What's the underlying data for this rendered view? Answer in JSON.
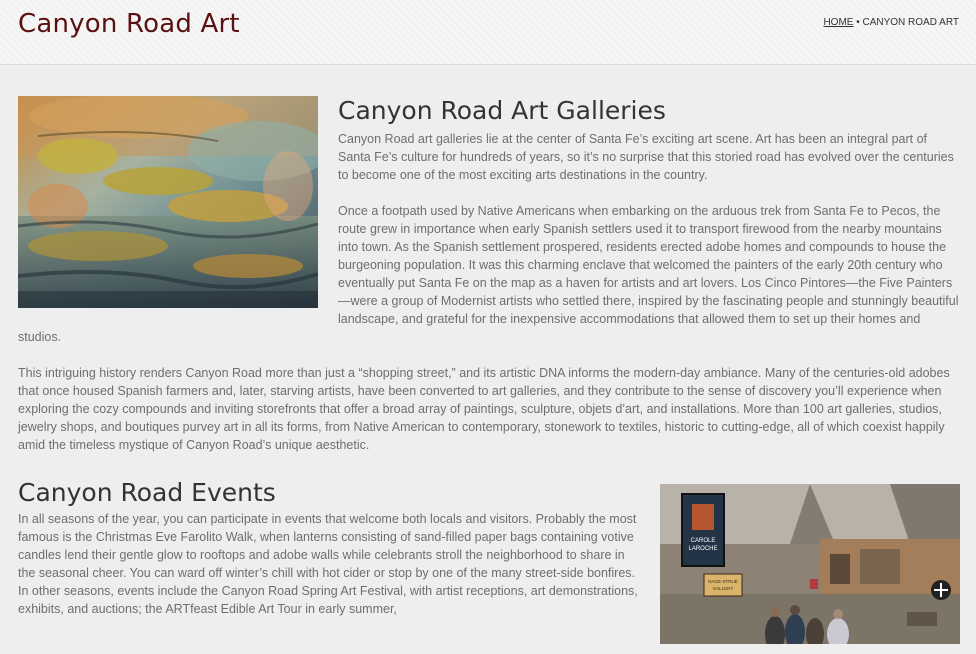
{
  "header": {
    "site_title": "Canyon Road Art",
    "breadcrumb": {
      "home": "HOME",
      "separator": " • ",
      "current": "CANYON ROAD ART"
    }
  },
  "galleries": {
    "title": "Canyon Road Art Galleries",
    "paragraphs": [
      "Canyon Road art galleries lie at the center of Santa Fe’s exciting art scene. Art has been an integral part of Santa Fe’s culture for hundreds of years, so it’s no surprise that this storied road has evolved over the centuries to become one of the most exciting arts destinations in the country.",
      "Once a footpath used by Native Americans when embarking on the arduous trek from Santa Fe to Pecos, the route grew in importance when early Spanish settlers used it to transport firewood from the nearby mountains into town. As the Spanish settlement prospered, residents erected adobe homes and compounds to house the burgeoning population. It was this charming enclave that welcomed the painters of the early 20th century who eventually put Santa Fe on the map as a haven for artists and art lovers. Los Cinco Pintores—the Five Painters—were a group of Modernist artists who settled there, inspired by the fascinating people and stunningly beautiful landscape, and grateful for the inexpensive accommodations that allowed them to set up their homes and studios.",
      "This intriguing history renders Canyon Road more than just a “shopping street,” and its artistic DNA informs the modern-day ambiance. Many of the centuries-old adobes that once housed Spanish farmers and, later, starving artists, have been converted to art galleries, and they contribute to the sense of discovery you’ll experience when exploring the cozy compounds and inviting storefronts that offer a broad array of paintings, sculpture, objets d’art, and installations. More than 100 art galleries, studios, jewelry shops, and boutiques purvey art in all its forms, from Native American to contemporary, stonework to textiles, historic to cutting-edge, all of which coexist happily amid the timeless mystique of Canyon Road’s unique aesthetic."
    ]
  },
  "events": {
    "title": "Canyon Road Events",
    "paragraphs": [
      "In all seasons of the year, you can participate in events that welcome both locals and visitors. Probably the most famous is the Christmas Eve Farolito Walk, when lanterns consisting of sand-filled paper bags containing votive candles lend their gentle glow to rooftops and adobe walls while celebrants stroll the neighborhood to share in the seasonal cheer. You can ward off winter’s chill with hot cider or stop by one of the many street-side bonfires. In other seasons, events include the Canyon Road Spring Art Festival, with artist receptions, art demonstrations, exhibits, and auctions; the ARTfeast Edible Art Tour in early summer,"
    ]
  },
  "photo_sign": {
    "gallery_sign_line1": "CAROLE",
    "gallery_sign_line2": "LAROCHE",
    "small_sign_line1": "NAGE-STRUE",
    "small_sign_line2": "GALLERY"
  }
}
